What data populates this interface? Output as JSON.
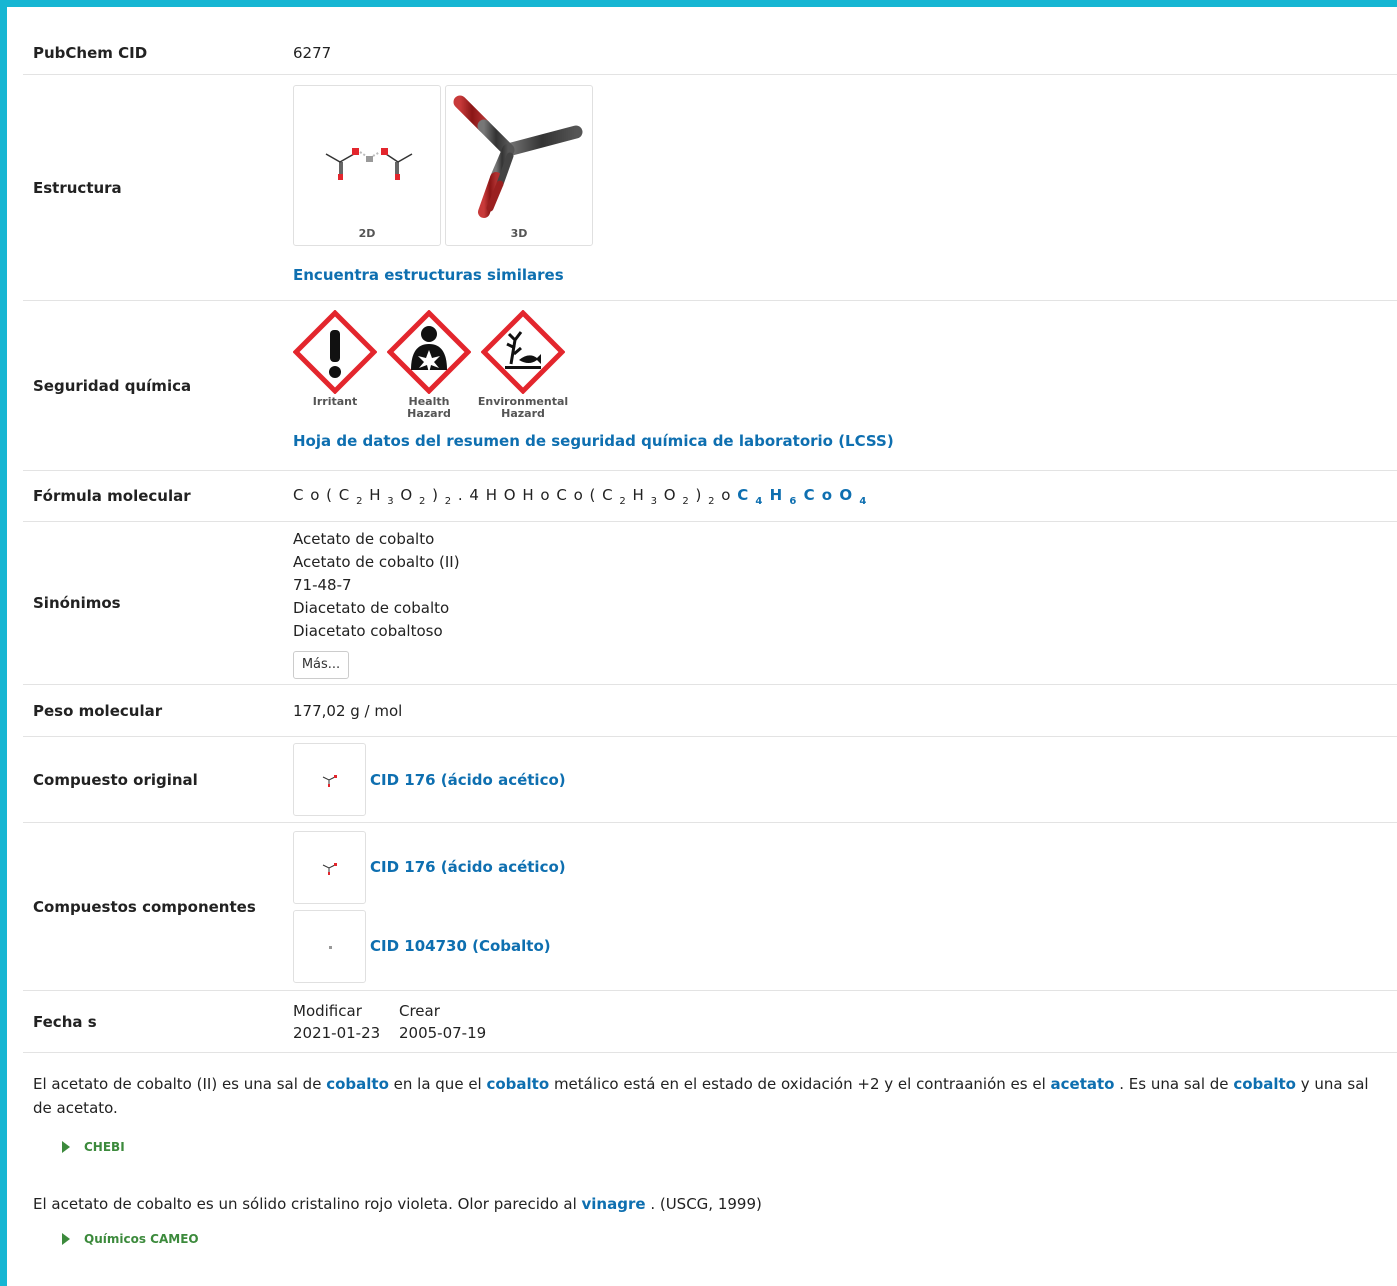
{
  "rows": {
    "cid": {
      "label": "PubChem CID",
      "value": "6277"
    },
    "structure": {
      "label": "Estructura",
      "cap2d": "2D",
      "cap3d": "3D",
      "link": "Encuentra estructuras similares"
    },
    "safety": {
      "label": "Seguridad química",
      "pictograms": [
        {
          "icon": "exclamation-icon",
          "caption": "Irritant"
        },
        {
          "icon": "health-hazard-icon",
          "caption": "Health Hazard"
        },
        {
          "icon": "environmental-hazard-icon",
          "caption": "Environmental Hazard"
        }
      ],
      "link": "Hoja de datos del resumen de seguridad química de laboratorio (LCSS)"
    },
    "formula": {
      "label": "Fórmula molecular"
    },
    "synonyms": {
      "label": "Sinónimos",
      "items": [
        "Acetato de cobalto",
        "Acetato de cobalto (II)",
        "71-48-7",
        "Diacetato de cobalto",
        "Diacetato cobaltoso"
      ],
      "more": "Más..."
    },
    "weight": {
      "label": "Peso molecular",
      "value": "177,02 g / mol"
    },
    "parent": {
      "label": "Compuesto original",
      "link": "CID 176 (ácido acético)"
    },
    "components": {
      "label": "Compuestos componentes",
      "items": [
        "CID 176 (ácido acético)",
        "CID 104730 (Cobalto)"
      ]
    },
    "dates": {
      "label": "Fecha s",
      "modify_h": "Modificar",
      "create_h": "Crear",
      "modify": "2021-01-23",
      "create": "2005-07-19"
    }
  },
  "description1": {
    "t1": "El acetato de cobalto (II) es una sal de ",
    "l1": "cobalto",
    "t2": " en la que el ",
    "l2": "cobalto",
    "t3": " metálico está en el estado de oxidación +2 y el contraanión es el ",
    "l3": "acetato",
    "t4": " . Es una sal de ",
    "l4": "cobalto",
    "t5": " y una sal de acetato."
  },
  "source1": "CHEBI",
  "description2": {
    "t1": "El acetato de cobalto es un sólido cristalino rojo violeta. Olor parecido al ",
    "l1": "vinagre",
    "t2": " . (USCG, 1999)"
  },
  "source2": "Químicos CAMEO",
  "colors": {
    "accent": "#16b6d3",
    "link": "#0e6fb0",
    "source": "#3c8a3c",
    "hazard": "#e3262d"
  }
}
